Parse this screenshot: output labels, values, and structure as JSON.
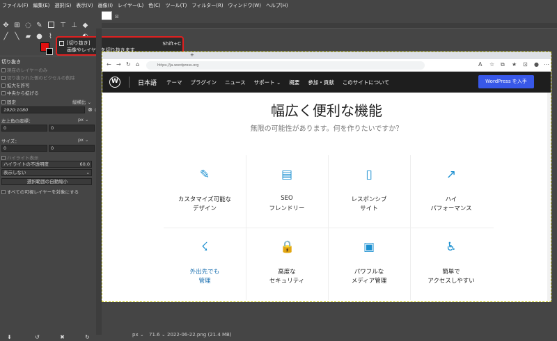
{
  "menu": [
    "ファイル(F)",
    "編集(E)",
    "選択(S)",
    "表示(V)",
    "画像(I)",
    "レイヤー(L)",
    "色(C)",
    "ツール(T)",
    "フィルター(R)",
    "ウィンドウ(W)",
    "ヘルプ(H)"
  ],
  "tooltip": {
    "title": "[切り抜き]",
    "desc": "画像やレイヤーを切り抜きます",
    "shortcut": "Shift+C"
  },
  "tool_options": {
    "title": "切り抜き",
    "opt_current_layer": "現在のレイヤーのみ",
    "opt_delete_pixels": "切り抜かれた側のピクセルの削除",
    "opt_allow_grow": "拡大を許可",
    "opt_from_center": "中央から拡げる",
    "fixed_label": "固定",
    "fixed_value": "縦横比",
    "ratio_value": "1920:1080",
    "position_label": "左上角の座標：",
    "position_unit": "px",
    "pos_x": "0",
    "pos_y": "0",
    "size_label": "サイズ：",
    "size_unit": "px",
    "size_x": "0",
    "size_y": "0",
    "highlight_label": "ハイライト表示",
    "highlight_opacity_label": "ハイライトの不透明度",
    "highlight_opacity_value": "60.0",
    "guide_value": "表示しない",
    "auto_shrink_label": "選択範囲の自動縮小",
    "all_layers_label": "すべての可視レイヤーを対象にする"
  },
  "browser": {
    "url": "https://ja.wordpress.org"
  },
  "wp": {
    "brand": "日本語",
    "nav": [
      "テーマ",
      "プラグイン",
      "ニュース",
      "サポート ⌄",
      "概要",
      "参加・貢献",
      "このサイトについて"
    ],
    "cta": "WordPress を入手",
    "title": "幅広く便利な機能",
    "subtitle": "無限の可能性があります。何を作りたいですか？",
    "features": [
      {
        "icon": "brush-icon",
        "l1": "カスタマイズ可能な",
        "l2": "デザイン"
      },
      {
        "icon": "seo-icon",
        "l1": "SEO",
        "l2": "フレンドリー"
      },
      {
        "icon": "phone-icon",
        "l1": "レスポンシブ",
        "l2": "サイト"
      },
      {
        "icon": "chart-icon",
        "l1": "ハイ",
        "l2": "パフォーマンス"
      },
      {
        "icon": "runner-icon",
        "l1": "外出先でも",
        "l2": "管理"
      },
      {
        "icon": "lock-icon",
        "l1": "高度な",
        "l2": "セキュリティ"
      },
      {
        "icon": "gallery-icon",
        "l1": "パワフルな",
        "l2": "メディア管理"
      },
      {
        "icon": "accessibility-icon",
        "l1": "簡単で",
        "l2": "アクセスしやすい"
      }
    ]
  },
  "status": {
    "unit": "px",
    "zoom": "71.6",
    "filename": "2022-06-22.png (21.4 MB)"
  }
}
